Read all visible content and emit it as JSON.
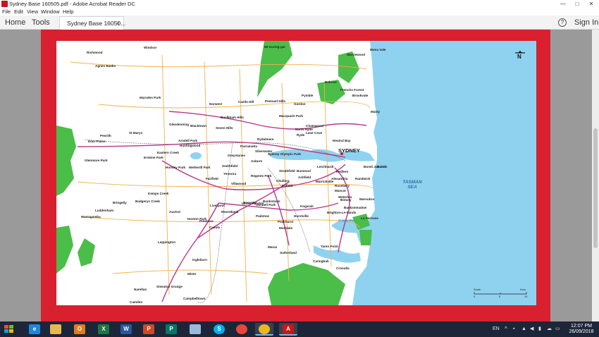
{
  "window": {
    "title": "Sydney Base 160505.pdf - Adobe Acrobat Reader DC",
    "controls": {
      "minimize": "—",
      "maximize": "□",
      "close": "✕"
    }
  },
  "menu": [
    "File",
    "Edit",
    "View",
    "Window",
    "Help"
  ],
  "toolbar": {
    "home": "Home",
    "tools": "Tools",
    "doc_tab": "Sydney Base 16050...",
    "doc_tab_close": "×",
    "help": "?",
    "signin": "Sign In"
  },
  "map": {
    "colors": {
      "frame": "#d9202f",
      "sea": "#8fd2f0",
      "park": "#4bbd49",
      "road_major": "#b8398a",
      "road_minor": "#f0b24a",
      "rail": "#6b6b6b"
    },
    "city": "SYDNEY",
    "sea": "TASMAN SEA",
    "bays": [
      "Botany Bay"
    ],
    "north": "N",
    "scale": {
      "title": "Scale",
      "unit": "Kms",
      "ticks": [
        "0",
        "5",
        "10"
      ]
    },
    "places": [
      "Windsor",
      "Richmond",
      "Agnes Banks",
      "Marsden Park",
      "Penrith",
      "Emu Plains",
      "St Marys",
      "Glenmore Park",
      "Glenmore Park",
      "Blacktown",
      "Glendenning",
      "Arndell Park",
      "Huntingwood",
      "Eastern Creek",
      "Erskine Park",
      "Horsley Park",
      "Wetherill Park",
      "Greystanes",
      "Fairfield",
      "Yennora",
      "Smithfield",
      "Villawood",
      "Norwest",
      "Castle Hill",
      "Baulkham Hills",
      "Seven Hills",
      "Pennant Hills",
      "Gordon",
      "Pymble",
      "Mona Vale",
      "Warriewood",
      "Belrose",
      "Frenchs Forest",
      "Brookvale",
      "Manly",
      "Chatswood",
      "Lane Cove",
      "North Ryde",
      "Ryde",
      "Macquarie Park",
      "Rydalmere",
      "Parramatta",
      "Silverwater",
      "Sydney Olympic Park",
      "Auburn",
      "Regents Park",
      "Strathfield",
      "Burwood",
      "Ashfield",
      "Marrickville",
      "Leichhardt",
      "Redfern",
      "Bondi Junction",
      "Bondi",
      "Randwick",
      "Rosebery",
      "Alexandria",
      "Mascot",
      "Botany",
      "Maroubra",
      "Banksmeadow",
      "La Perouse",
      "Bankstown",
      "Chullora",
      "Enfield",
      "Condell Park",
      "Revesby",
      "Padstow",
      "Peakhurst",
      "Hurstville",
      "Kogarah",
      "Brighton-Le-Sands",
      "Mortdale",
      "Sutherland",
      "Caringbah",
      "Taren Point",
      "Cronulla",
      "Menai",
      "Lucas Heights",
      "Kemps Creek",
      "Badgerys Creek",
      "Luddenham",
      "Warragamba",
      "Bringelly",
      "Austral",
      "Hoxton Park",
      "Prestons",
      "Liverpool",
      "Moorebank",
      "Casula",
      "Leppington",
      "Ingleburn",
      "Minto",
      "Narellan",
      "Smeaton Grange",
      "Camden",
      "Campbelltown",
      "Mt Kuring-gai",
      "Neutral Bay",
      "Sydney",
      "Waterloo"
    ]
  }
}
